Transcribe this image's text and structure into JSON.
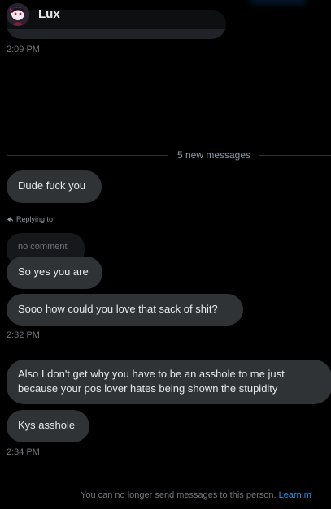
{
  "header": {
    "contact_name": "Lux"
  },
  "messages": {
    "first_timestamp": "2:09 PM",
    "new_messages_divider": "5 new messages",
    "m1": "Dude fuck you",
    "reply_label": "Replying to",
    "reply_quote": "no comment",
    "m2": "So yes you are",
    "m3": "Sooo how could you love that sack of shit?",
    "ts2": "2:32 PM",
    "m4": "Also I don't get why you have to be an asshole to me just because your pos lover hates being shown the stupidity",
    "m5": "Kys asshole",
    "ts3": "2:34 PM"
  },
  "footer": {
    "notice": "You can no longer send messages to this person.",
    "learn_more": "Learn m"
  },
  "colors": {
    "background": "#000000",
    "bubble": "#2f3336",
    "muted_text": "#71767b",
    "link": "#1d9bf0"
  }
}
